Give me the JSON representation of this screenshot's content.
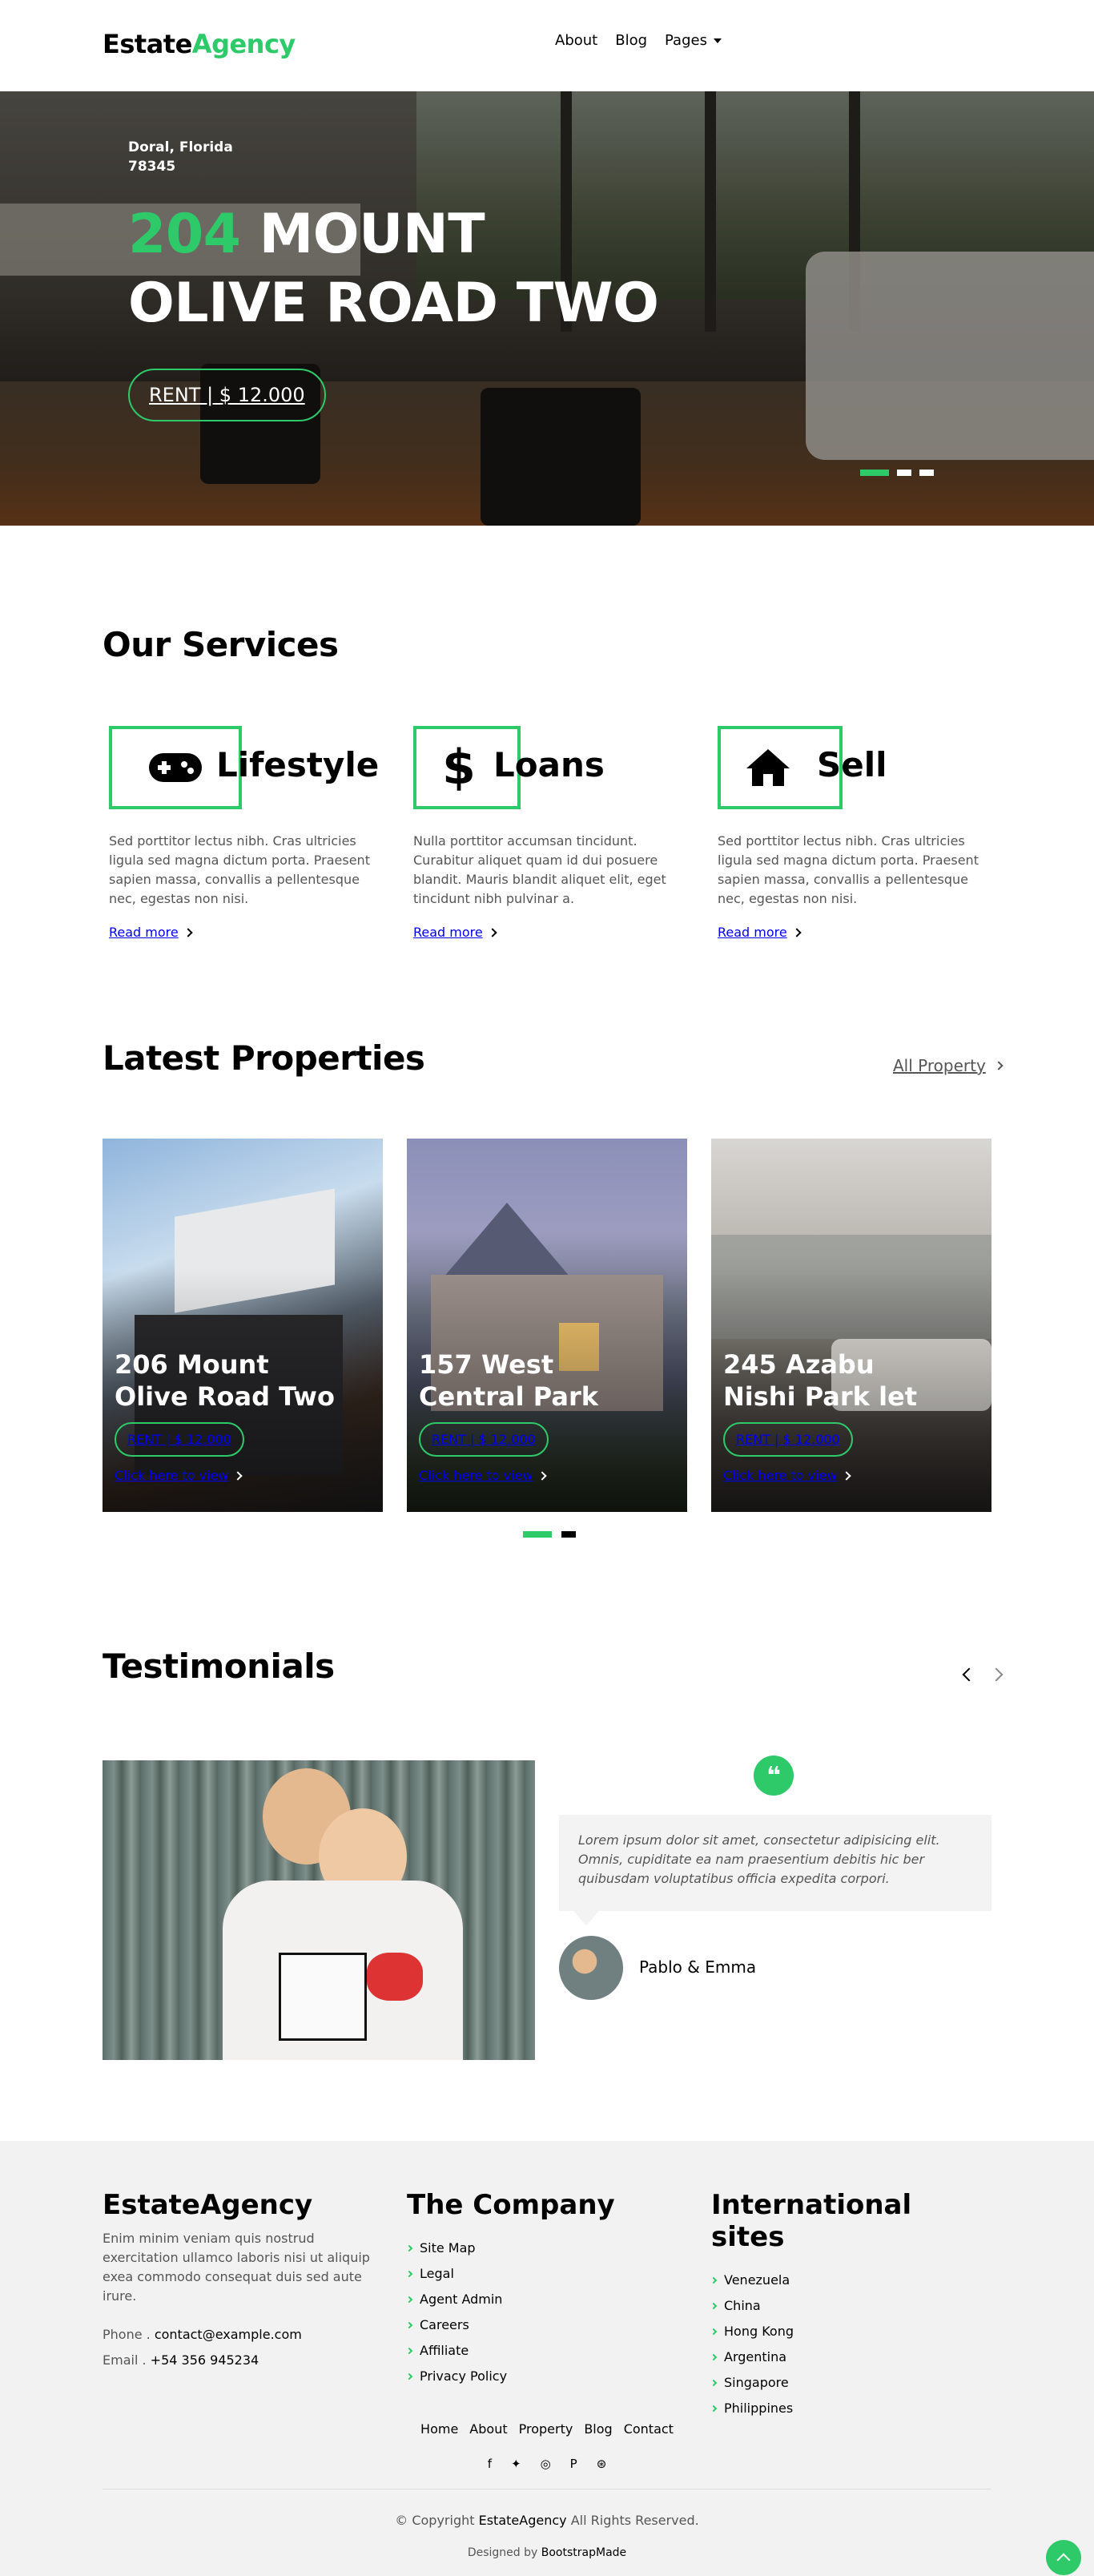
{
  "brand": {
    "name_part1": "Estate",
    "name_part2": "Agency"
  },
  "nav": {
    "items": [
      "About",
      "Blog"
    ],
    "pages_label": "Pages"
  },
  "hero": {
    "city_line1": "Doral, Florida",
    "city_line2": "78345",
    "title_num": "204",
    "title_rest1": "Mount",
    "title_line2": "Olive Road Two",
    "price": "RENT | $ 12.000",
    "slides": 3,
    "active_slide": 1
  },
  "services": {
    "title": "Our Services",
    "items": [
      {
        "name": "Lifestyle",
        "icon": "gamepad-icon",
        "text": "Sed porttitor lectus nibh. Cras ultricies ligula sed magna dictum porta. Praesent sapien massa, convallis a pellentesque nec, egestas non nisi.",
        "link": "Read more"
      },
      {
        "name": "Loans",
        "icon": "dollar-icon",
        "text": "Nulla porttitor accumsan tincidunt. Curabitur aliquet quam id dui posuere blandit. Mauris blandit aliquet elit, eget tincidunt nibh pulvinar a.",
        "link": "Read more"
      },
      {
        "name": "Sell",
        "icon": "home-icon",
        "text": "Sed porttitor lectus nibh. Cras ultricies ligula sed magna dictum porta. Praesent sapien massa, convallis a pellentesque nec, egestas non nisi.",
        "link": "Read more"
      }
    ]
  },
  "properties": {
    "title": "Latest Properties",
    "all_link": "All Property",
    "items": [
      {
        "line1": "206 Mount",
        "line2": "Olive Road Two",
        "price": "RENT | $ 12.000",
        "link": "Click here to view"
      },
      {
        "line1": "157 West",
        "line2": "Central Park",
        "price": "RENT | $ 12.000",
        "link": "Click here to view"
      },
      {
        "line1": "245 Azabu",
        "line2": "Nishi Park let",
        "price": "RENT | $ 12.000",
        "link": "Click here to view"
      }
    ]
  },
  "testimonials": {
    "title": "Testimonials",
    "quote": "Lorem ipsum dolor sit amet, consectetur adipisicing elit. Omnis, cupiditate ea nam praesentium debitis hic ber quibusdam voluptatibus officia expedita corpori.",
    "author": "Pablo & Emma"
  },
  "footer": {
    "col1": {
      "title": "EstateAgency",
      "text": "Enim minim veniam quis nostrud exercitation ullamco laboris nisi ut aliquip exea commodo consequat duis sed aute irure.",
      "phone_label": "Phone .",
      "phone_value": "contact@example.com",
      "email_label": "Email .",
      "email_value": "+54 356 945234"
    },
    "col2": {
      "title": "The Company",
      "links": [
        "Site Map",
        "Legal",
        "Agent Admin",
        "Careers",
        "Affiliate",
        "Privacy Policy"
      ]
    },
    "col3": {
      "title": "International sites",
      "links": [
        "Venezuela",
        "China",
        "Hong Kong",
        "Argentina",
        "Singapore",
        "Philippines"
      ]
    },
    "nav": [
      "Home",
      "About",
      "Property",
      "Blog",
      "Contact"
    ],
    "social": [
      "facebook-icon",
      "twitter-icon",
      "instagram-icon",
      "pinterest-icon",
      "dribbble-icon"
    ],
    "social_glyphs": [
      "f",
      "✦",
      "◎",
      "P",
      "⊛"
    ],
    "copyright_prefix": "© Copyright",
    "copyright_brand": "EstateAgency",
    "copyright_suffix": "All Rights Reserved.",
    "designed_prefix": "Designed by",
    "designed_by": "BootstrapMade"
  },
  "colors": {
    "accent": "#2eca6a",
    "footer_bg": "#f2f2f2"
  }
}
